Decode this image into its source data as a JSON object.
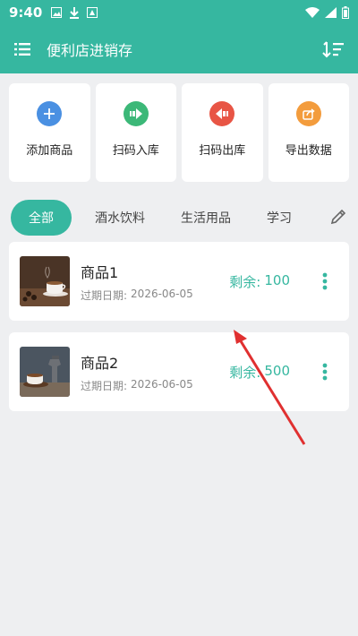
{
  "status": {
    "time": "9:40"
  },
  "appbar": {
    "title": "便利店进销存"
  },
  "actions": [
    {
      "label": "添加商品",
      "icon": "plus-icon",
      "color": "#4a90e2"
    },
    {
      "label": "扫码入库",
      "icon": "import-icon",
      "color": "#3cb878"
    },
    {
      "label": "扫码出库",
      "icon": "export-icon",
      "color": "#e85545"
    },
    {
      "label": "导出数据",
      "icon": "share-icon",
      "color": "#f39c3d"
    }
  ],
  "tabs": [
    "全部",
    "酒水饮料",
    "生活用品",
    "学习"
  ],
  "products": [
    {
      "name": "商品1",
      "expiry_label": "过期日期:",
      "expiry": "2026-06-05",
      "stock_label": "剩余:",
      "stock": "100"
    },
    {
      "name": "商品2",
      "expiry_label": "过期日期:",
      "expiry": "2026-06-05",
      "stock_label": "剩余:",
      "stock": "500"
    }
  ],
  "colors": {
    "accent": "#36b7a0",
    "arrow": "#e03030"
  }
}
